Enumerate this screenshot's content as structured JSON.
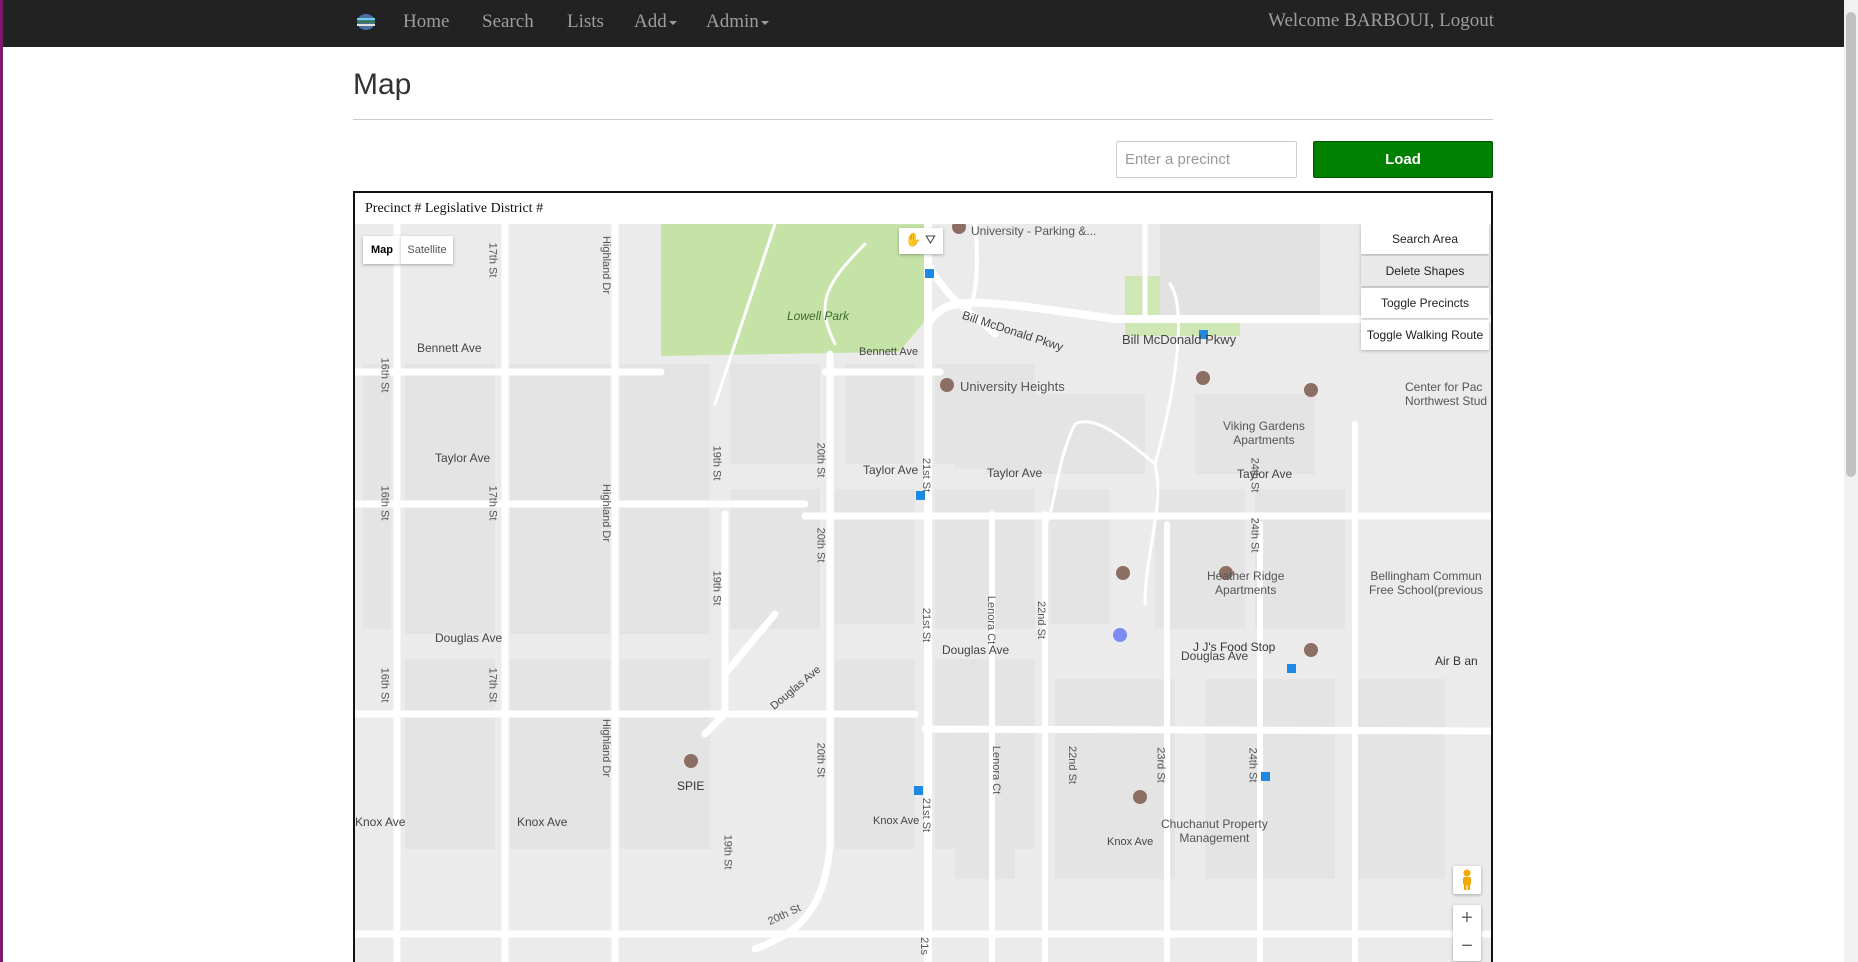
{
  "nav": {
    "items": [
      {
        "label": "Home"
      },
      {
        "label": "Search"
      },
      {
        "label": "Lists"
      },
      {
        "label": "Add"
      },
      {
        "label": "Admin"
      }
    ],
    "welcome": "Welcome BARBOUI,",
    "logout": "Logout"
  },
  "page": {
    "title": "Map",
    "precinct_placeholder": "Enter a precinct",
    "load_label": "Load"
  },
  "map": {
    "header": "Precinct # Legislative District #",
    "type_map": "Map",
    "type_satellite": "Satellite",
    "controls": [
      "Search Area",
      "Delete Shapes",
      "Toggle Precincts",
      "Toggle Walking Route"
    ],
    "zoom_in": "+",
    "zoom_out": "−",
    "streets": {
      "bennett_w": "Bennett Ave",
      "bennett_e": "Bennett Ave",
      "taylor_w": "Taylor Ave",
      "taylor_m": "Taylor Ave",
      "taylor_e1": "Taylor Ave",
      "taylor_e2": "Taylor Ave",
      "douglas_w": "Douglas Ave",
      "douglas_m": "Douglas Ave",
      "douglas_e": "Douglas Ave",
      "douglas_diag": "Douglas Ave",
      "knox_w1": "Knox Ave",
      "knox_w2": "Knox Ave",
      "knox_m": "Knox Ave",
      "knox_e": "Knox Ave",
      "mcdonald1": "Bill McDonald Pkwy",
      "mcdonald2": "Bill McDonald Pkwy",
      "st16_a": "16th St",
      "st16_b": "16th St",
      "st16_c": "16th St",
      "st17_a": "17th St",
      "st17_b": "17th St",
      "st17_c": "17th St",
      "highland_a": "Highland Dr",
      "highland_b": "Highland Dr",
      "highland_c": "Highland Dr",
      "st19_a": "19th St",
      "st19_b": "19th St",
      "st19_c": "19th St",
      "st20_a": "20th St",
      "st20_b": "20th St",
      "st20_c": "20th St",
      "st20_d": "20th St",
      "st21_a": "21st St",
      "st21_b": "21st St",
      "st21_c": "21st St",
      "st21_d": "21s",
      "lenora_a": "Lenora Ct",
      "lenora_b": "Lenora Ct",
      "st22_a": "22nd St",
      "st22_b": "22nd St",
      "st23": "23rd St",
      "st24_a": "24th St",
      "st24_b": "24th St",
      "st24_c": "24th St"
    },
    "places": {
      "lowell_park": "Lowell Park",
      "univ_parking": "University - Parking &...",
      "univ_heights": "University Heights",
      "viking_gardens_1": "Viking Gardens",
      "viking_gardens_2": "Apartments",
      "center_pacific_1": "Center for Pac",
      "center_pacific_2": "Northwest Stud",
      "heather_ridge_1": "Heather Ridge",
      "heather_ridge_2": "Apartments",
      "bellingham_school_1": "Bellingham Commun",
      "bellingham_school_2": "Free School(previous",
      "jj_food": "J J's Food Stop",
      "air_b": "Air B an",
      "spie": "SPIE",
      "chuchanut_1": "Chuchanut Property",
      "chuchanut_2": "Management"
    }
  }
}
